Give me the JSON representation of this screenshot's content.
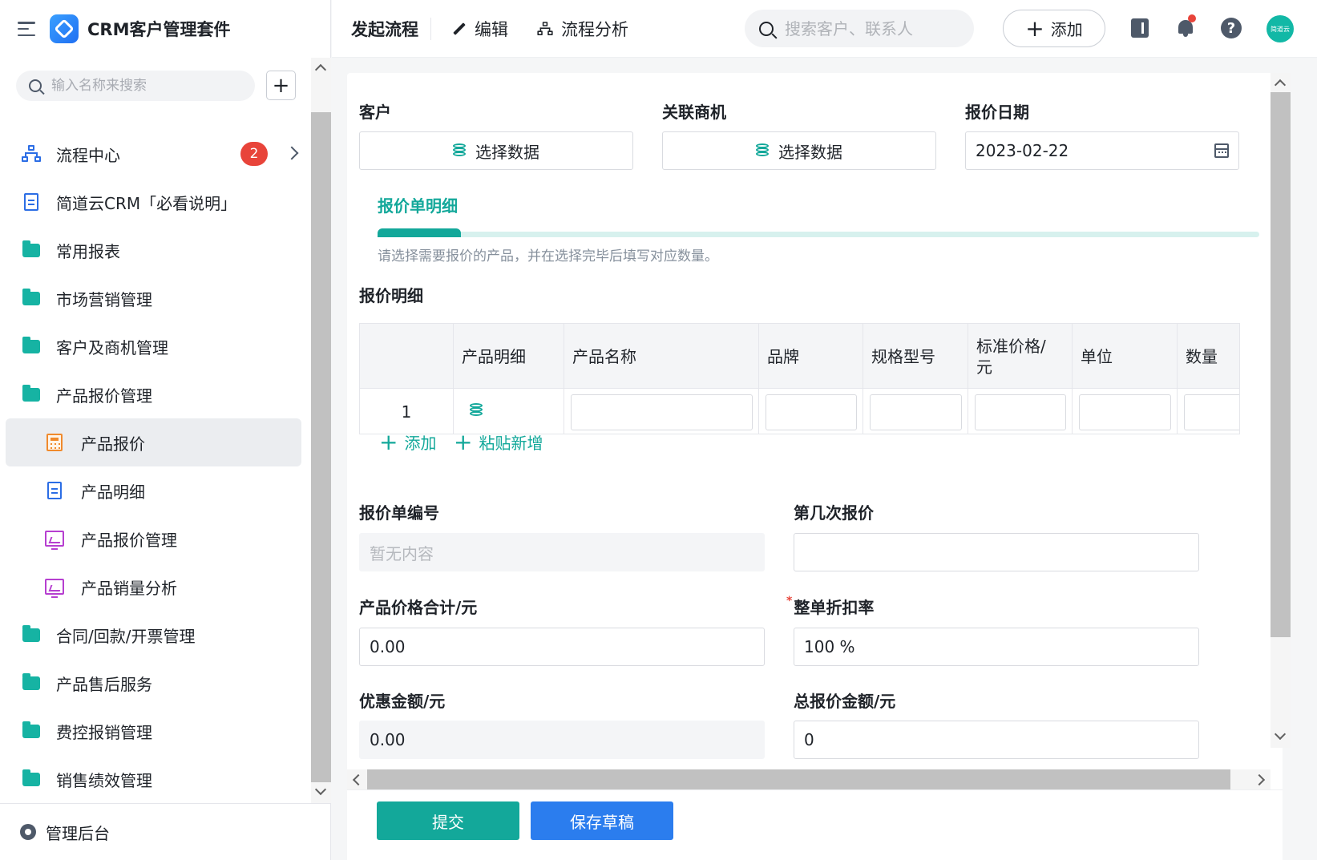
{
  "app": {
    "title": "CRM客户管理套件"
  },
  "sidebar": {
    "search_placeholder": "输入名称来搜索",
    "add_label": "+",
    "items": [
      {
        "label": "流程中心",
        "icon": "flow-icon",
        "badge": "2"
      },
      {
        "label": "简道云CRM「必看说明」",
        "icon": "document-icon"
      },
      {
        "label": "常用报表",
        "icon": "folder-icon"
      },
      {
        "label": "市场营销管理",
        "icon": "folder-icon"
      },
      {
        "label": "客户及商机管理",
        "icon": "folder-icon"
      },
      {
        "label": "产品报价管理",
        "icon": "folder-open-icon"
      },
      {
        "label": "产品报价",
        "icon": "calculator-icon",
        "active": true
      },
      {
        "label": "产品明细",
        "icon": "document-icon"
      },
      {
        "label": "产品报价管理",
        "icon": "dashboard-icon"
      },
      {
        "label": "产品销量分析",
        "icon": "dashboard-icon"
      },
      {
        "label": "合同/回款/开票管理",
        "icon": "folder-icon"
      },
      {
        "label": "产品售后服务",
        "icon": "folder-icon"
      },
      {
        "label": "费控报销管理",
        "icon": "folder-icon"
      },
      {
        "label": "销售绩效管理",
        "icon": "folder-icon"
      }
    ],
    "footer_label": "管理后台"
  },
  "topbar": {
    "launch_label": "发起流程",
    "edit_label": "编辑",
    "analysis_label": "流程分析",
    "search_placeholder": "搜索客户、联系人",
    "add_label": "添加",
    "avatar_text": "简道云"
  },
  "form": {
    "customer_label": "客户",
    "customer_button": "选择数据",
    "opportunity_label": "关联商机",
    "opportunity_button": "选择数据",
    "date_label": "报价日期",
    "date_value": "2023-02-22",
    "section_title": "报价单明细",
    "section_desc": "请选择需要报价的产品，并在选择完毕后填写对应数量。",
    "detail_label": "报价明细",
    "table": {
      "columns": [
        "",
        "产品明细",
        "产品名称",
        "品牌",
        "规格型号",
        "标准价格/元",
        "单位",
        "数量"
      ],
      "rows": [
        {
          "index": "1"
        }
      ]
    },
    "add_row_label": "添加",
    "paste_add_label": "粘贴新增",
    "quote_no_label": "报价单编号",
    "quote_no_value": "暂无内容",
    "quote_round_label": "第几次报价",
    "quote_round_value": "",
    "price_total_label": "产品价格合计/元",
    "price_total_value": "0.00",
    "discount_label": "整单折扣率",
    "discount_required": "*",
    "discount_value": "100  %",
    "coupon_label": "优惠金额/元",
    "coupon_value": "0.00",
    "total_label": "总报价金额/元",
    "total_value": "0"
  },
  "actions": {
    "submit_label": "提交",
    "draft_label": "保存草稿"
  },
  "colors": {
    "primary": "#13a89a",
    "draft_button": "#2b7dee",
    "badge": "#e8443a"
  }
}
